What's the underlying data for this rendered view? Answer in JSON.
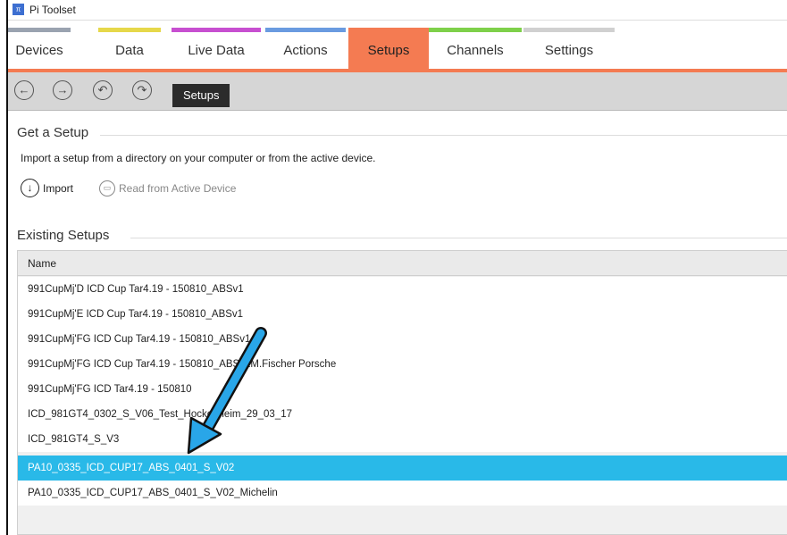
{
  "window": {
    "title": "Pi Toolset"
  },
  "tabs": [
    {
      "label": "Devices",
      "color": "#9aa3b0"
    },
    {
      "label": "Data",
      "color": "#e6d84a"
    },
    {
      "label": "Live Data",
      "color": "#c74fd0"
    },
    {
      "label": "Actions",
      "color": "#6a9be0"
    },
    {
      "label": "Setups",
      "color": "#f47b52",
      "active": true
    },
    {
      "label": "Channels",
      "color": "#7ed04a"
    },
    {
      "label": "Settings",
      "color": "#d0d0d0"
    }
  ],
  "toolbar": {
    "back_icon": "back-arrow-icon",
    "forward_icon": "forward-arrow-icon",
    "undo_icon": "undo-icon",
    "redo_icon": "redo-icon",
    "breadcrumb": "Setups"
  },
  "get_setup": {
    "title": "Get a Setup",
    "description": "Import a setup from a directory on your computer or from the active device.",
    "import_label": "Import",
    "read_label": "Read from Active Device"
  },
  "existing": {
    "title": "Existing Setups",
    "column_header": "Name",
    "rows": [
      "991CupMj'D ICD Cup Tar4.19 - 150810_ABSv1",
      "991CupMj'E ICD Cup Tar4.19 - 150810_ABSv1",
      "991CupMj'FG ICD Cup Tar4.19 - 150810_ABSv1",
      "991CupMj'FG ICD Cup Tar4.19 - 150810_ABSv1M.Fischer Porsche",
      "991CupMj'FG ICD Tar4.19 - 150810",
      "ICD_981GT4_0302_S_V06_Test_Hockenheim_29_03_17",
      "ICD_981GT4_S_V3",
      "PA10_0335_ICD_CUP17_ABS_0401_S_V02",
      "PA10_0335_ICD_CUP17_ABS_0401_S_V02_Michelin"
    ],
    "selected_index": 7
  },
  "colors": {
    "accent": "#f47b52",
    "selection": "#29b9e8",
    "arrow": "#29a6e8"
  }
}
